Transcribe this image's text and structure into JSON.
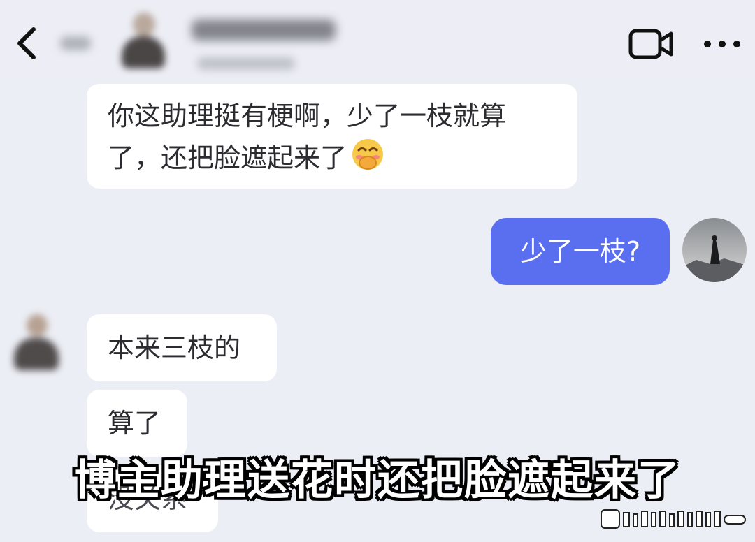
{
  "header": {
    "back_icon": "chevron-left-icon",
    "video_icon": "video-camera-icon",
    "more_icon": "more-horizontal-icon"
  },
  "messages": [
    {
      "direction": "incoming",
      "lines": [
        "你这助理挺有梗啊，少了一枝就算",
        "了，还把脸遮起来了"
      ],
      "emoji": "face-covering-mouth-emoji"
    },
    {
      "direction": "outgoing",
      "text": "少了一枝?"
    },
    {
      "direction": "incoming",
      "text": "本来三枝的"
    },
    {
      "direction": "incoming",
      "text": "算了"
    },
    {
      "direction": "incoming",
      "text": "没关系"
    }
  ],
  "caption": "博主助理送花时还把脸遮起来了",
  "colors": {
    "background": "#eceef5",
    "incoming_bubble": "#ffffff",
    "outgoing_bubble": "#5a6ef0",
    "text": "#2b2b30"
  }
}
